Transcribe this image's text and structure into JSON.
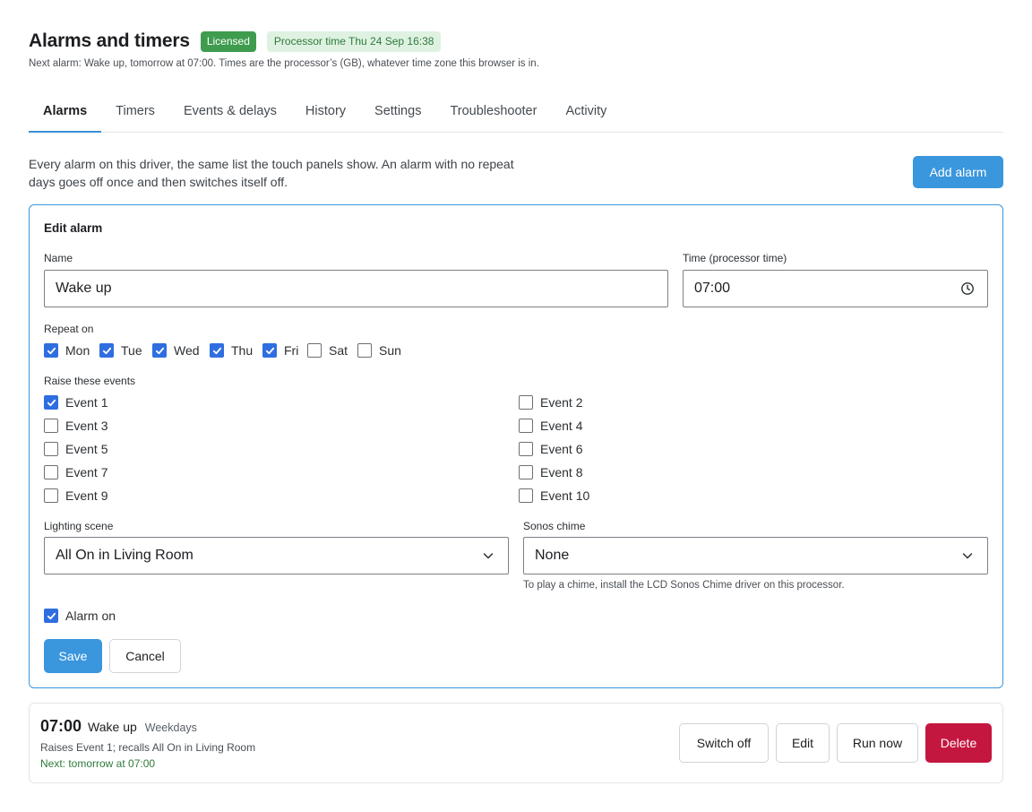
{
  "header": {
    "title": "Alarms and timers",
    "licensed_badge": "Licensed",
    "processor_time_badge": "Processor time Thu 24 Sep 16:38",
    "subtitle": "Next alarm: Wake up, tomorrow at 07:00. Times are the processor’s (GB), whatever time zone this browser is in."
  },
  "tabs": [
    {
      "label": "Alarms",
      "active": true
    },
    {
      "label": "Timers"
    },
    {
      "label": "Events & delays"
    },
    {
      "label": "History"
    },
    {
      "label": "Settings"
    },
    {
      "label": "Troubleshooter"
    },
    {
      "label": "Activity"
    }
  ],
  "intro": {
    "text": "Every alarm on this driver, the same list the touch panels show. An alarm with no repeat days goes off once and then switches itself off.",
    "add_button": "Add alarm"
  },
  "edit": {
    "title": "Edit alarm",
    "name_label": "Name",
    "name_value": "Wake up",
    "time_label": "Time (processor time)",
    "time_value": "07:00",
    "repeat_label": "Repeat on",
    "days": [
      {
        "label": "Mon",
        "checked": true
      },
      {
        "label": "Tue",
        "checked": true
      },
      {
        "label": "Wed",
        "checked": true
      },
      {
        "label": "Thu",
        "checked": true
      },
      {
        "label": "Fri",
        "checked": true
      },
      {
        "label": "Sat",
        "checked": false
      },
      {
        "label": "Sun",
        "checked": false
      }
    ],
    "events_label": "Raise these events",
    "events": [
      {
        "label": "Event 1",
        "checked": true
      },
      {
        "label": "Event 2",
        "checked": false
      },
      {
        "label": "Event 3",
        "checked": false
      },
      {
        "label": "Event 4",
        "checked": false
      },
      {
        "label": "Event 5",
        "checked": false
      },
      {
        "label": "Event 6",
        "checked": false
      },
      {
        "label": "Event 7",
        "checked": false
      },
      {
        "label": "Event 8",
        "checked": false
      },
      {
        "label": "Event 9",
        "checked": false
      },
      {
        "label": "Event 10",
        "checked": false
      }
    ],
    "scene_label": "Lighting scene",
    "scene_value": "All On in Living Room",
    "chime_label": "Sonos chime",
    "chime_value": "None",
    "chime_hint": "To play a chime, install the LCD Sonos Chime driver on this processor.",
    "alarm_on_label": "Alarm on",
    "alarm_on": true,
    "save_label": "Save",
    "cancel_label": "Cancel"
  },
  "alarm": {
    "time": "07:00",
    "name": "Wake up",
    "days": "Weekdays",
    "description": "Raises Event 1; recalls All On in Living Room",
    "next": "Next: tomorrow at 07:00",
    "switch_off_label": "Switch off",
    "edit_label": "Edit",
    "run_now_label": "Run now",
    "delete_label": "Delete"
  },
  "colors": {
    "accent": "#3a96dd",
    "checkbox": "#2f6ee0",
    "licensed": "#3f9c4e",
    "danger": "#c4173f"
  }
}
